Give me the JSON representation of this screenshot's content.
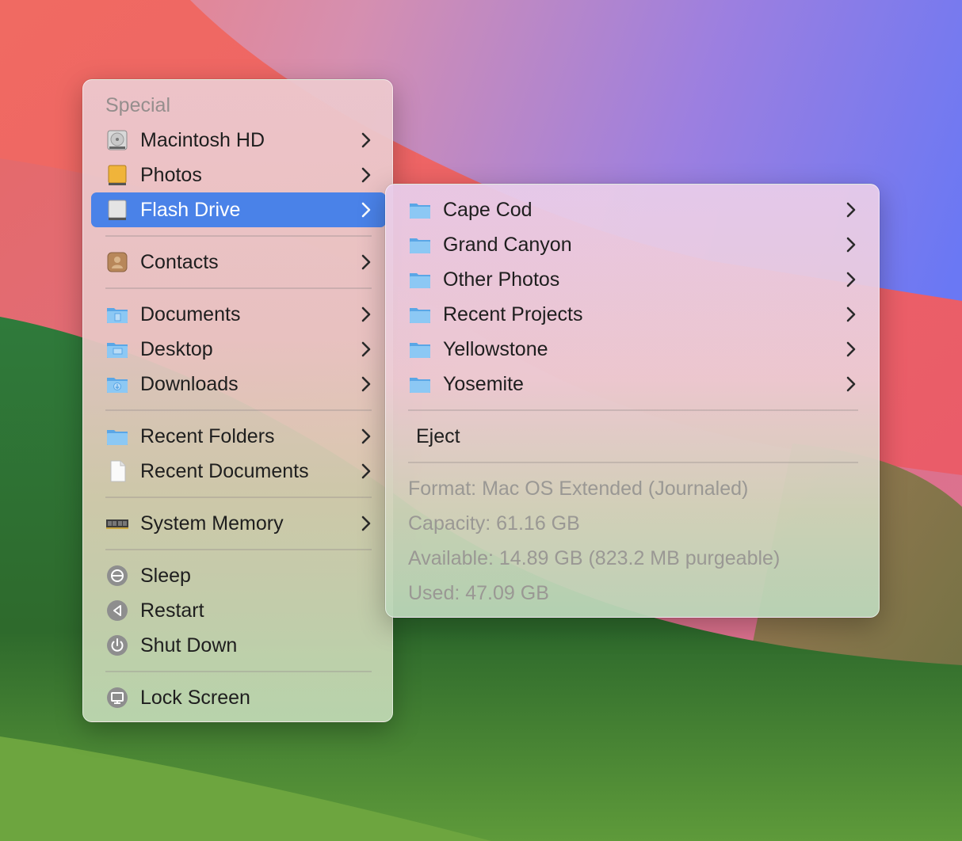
{
  "main_menu": {
    "section_header": "Special",
    "items": [
      {
        "label": "Macintosh HD",
        "icon": "hard-drive-icon"
      },
      {
        "label": "Photos",
        "icon": "photos-drive-icon"
      },
      {
        "label": "Flash Drive",
        "icon": "flash-drive-icon",
        "highlighted": true
      },
      {
        "label": "Contacts",
        "icon": "contacts-icon"
      },
      {
        "label": "Documents",
        "icon": "documents-folder-icon"
      },
      {
        "label": "Desktop",
        "icon": "desktop-folder-icon"
      },
      {
        "label": "Downloads",
        "icon": "downloads-folder-icon"
      },
      {
        "label": "Recent Folders",
        "icon": "folder-icon"
      },
      {
        "label": "Recent Documents",
        "icon": "document-icon"
      },
      {
        "label": "System Memory",
        "icon": "memory-chip-icon"
      },
      {
        "label": "Sleep",
        "icon": "sleep-icon"
      },
      {
        "label": "Restart",
        "icon": "restart-icon"
      },
      {
        "label": "Shut Down",
        "icon": "power-icon"
      },
      {
        "label": "Lock Screen",
        "icon": "lock-screen-icon"
      }
    ]
  },
  "sub_menu": {
    "folders": [
      {
        "label": "Cape Cod",
        "icon": "folder-icon"
      },
      {
        "label": "Grand Canyon",
        "icon": "folder-icon"
      },
      {
        "label": "Other Photos",
        "icon": "folder-icon"
      },
      {
        "label": "Recent Projects",
        "icon": "folder-icon"
      },
      {
        "label": "Yellowstone",
        "icon": "folder-icon"
      },
      {
        "label": "Yosemite",
        "icon": "folder-icon"
      }
    ],
    "eject_label": "Eject",
    "info": {
      "format": "Format: Mac OS Extended (Journaled)",
      "capacity": "Capacity: 61.16 GB",
      "available": "Available: 14.89 GB (823.2 MB purgeable)",
      "used": "Used: 47.09 GB"
    }
  },
  "colors": {
    "highlight": "#4a82e8",
    "folder_blue": "#6fb7ee",
    "disabled_text": "#9a9894"
  }
}
